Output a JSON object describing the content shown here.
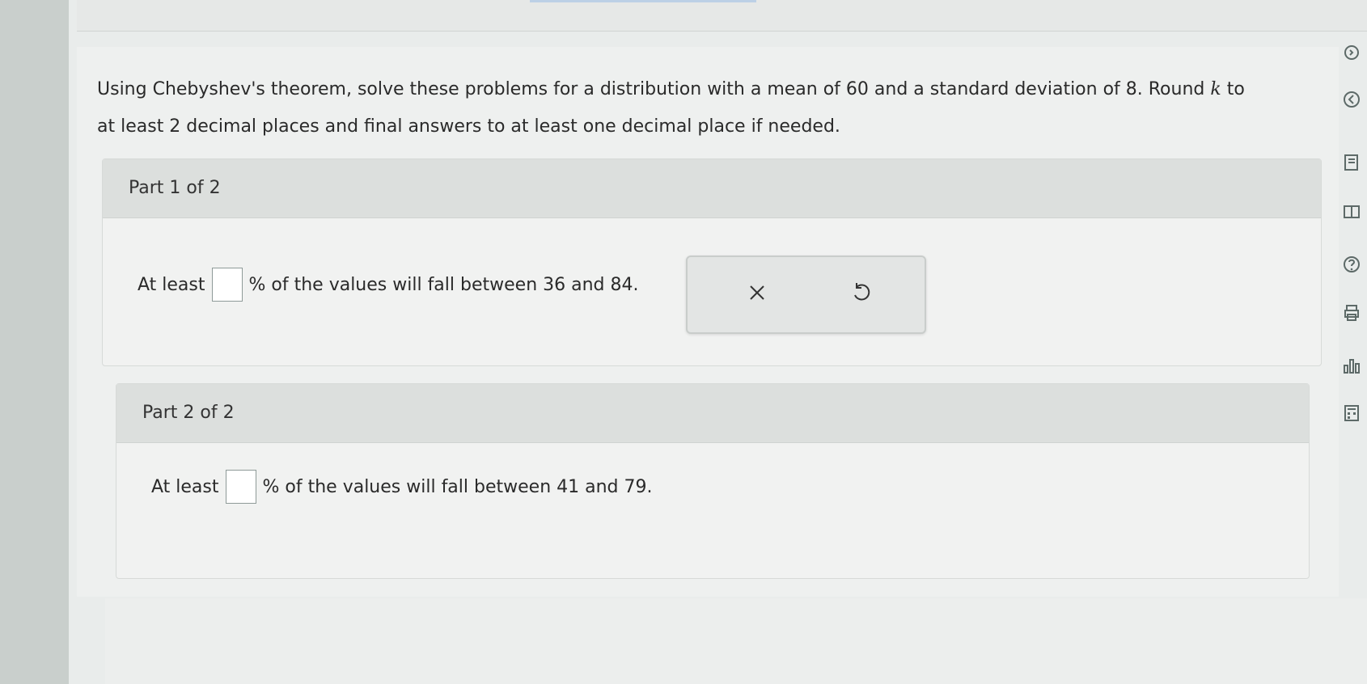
{
  "instructions": {
    "line1_part1": "Using Chebyshev's theorem, solve these problems for a distribution with a mean of 60 and a standard deviation of 8. Round ",
    "k": "k",
    "line1_part2": " to",
    "line2": "at least 2 decimal places and final answers to at least one decimal place if needed."
  },
  "parts": [
    {
      "header": "Part 1 of 2",
      "prefix": "At least",
      "suffix": "% of the values will fall between 36 and 84.",
      "answer_value": ""
    },
    {
      "header": "Part 2 of 2",
      "prefix": "At least",
      "suffix": "% of the values will fall between 41 and 79.",
      "answer_value": ""
    }
  ],
  "actions": {
    "clear_icon": "close-icon",
    "undo_icon": "undo-icon"
  },
  "rail_icons": [
    "circle-arrow-icon",
    "chevron-left-icon",
    "document-list-icon",
    "book-icon",
    "help-icon",
    "print-icon",
    "chart-icon",
    "calculator-icon"
  ],
  "colors": {
    "page_background": "#eef0ef",
    "part_header": "#dcdfdd",
    "answer_border": "#8e9a98"
  }
}
